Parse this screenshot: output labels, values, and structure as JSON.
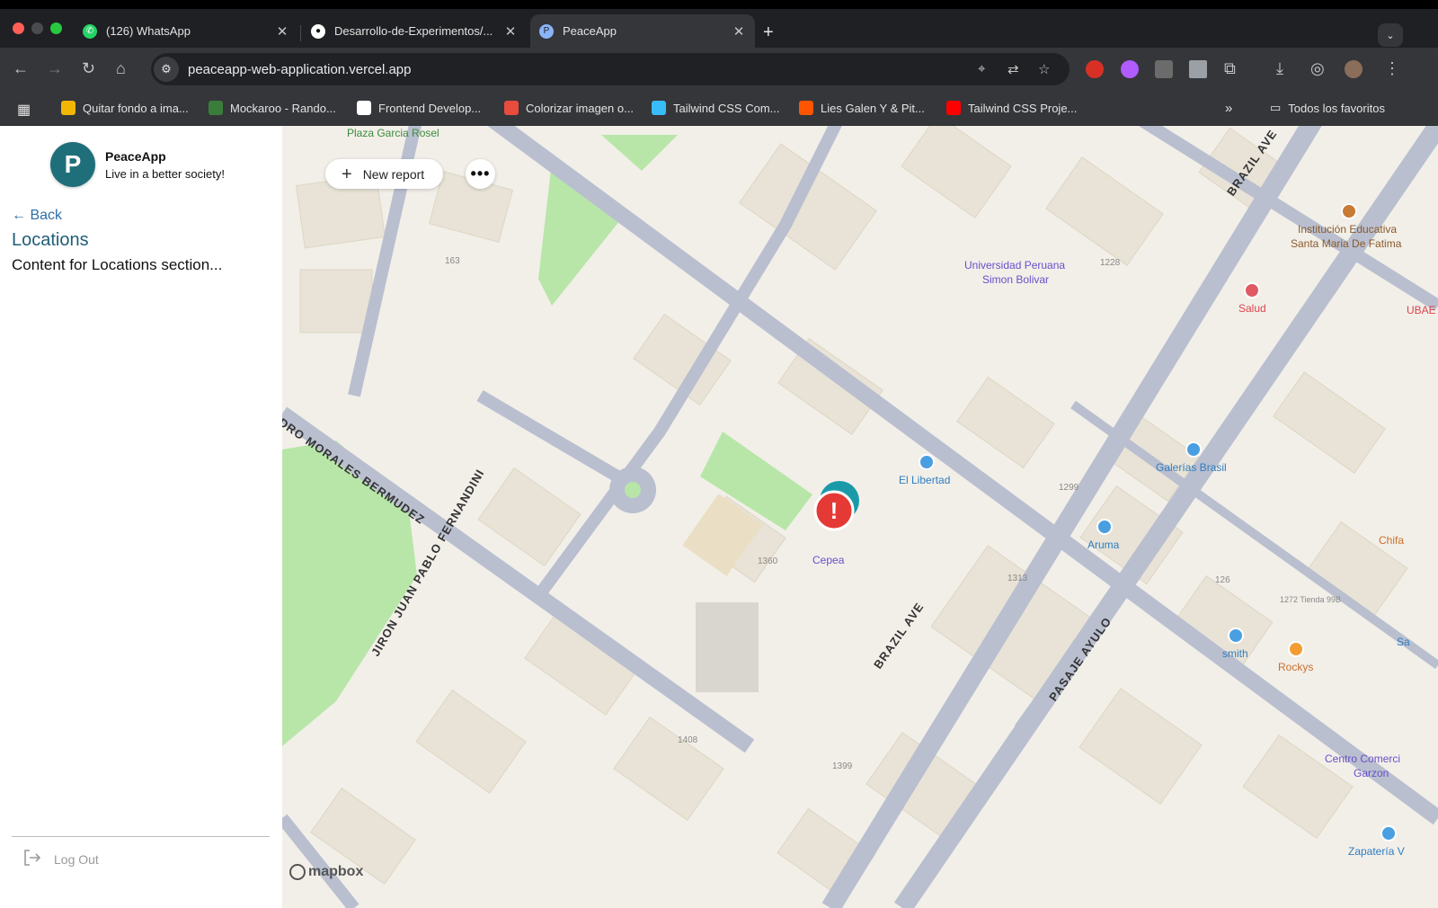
{
  "browser": {
    "tabs": [
      {
        "title": "(126) WhatsApp",
        "icon": "whatsapp-icon",
        "close": "✕"
      },
      {
        "title": "Desarrollo-de-Experimentos/...",
        "icon": "github-icon",
        "close": "✕"
      },
      {
        "title": "PeaceApp",
        "icon": "peaceapp-icon",
        "close": "✕"
      }
    ],
    "url": "peaceapp-web-application.vercel.app",
    "bookmarks": [
      {
        "label": "Quitar fondo a ima...",
        "color": "#f2b705"
      },
      {
        "label": "Mockaroo - Rando...",
        "color": "#3a7d3a"
      },
      {
        "label": "Frontend Develop...",
        "color": "#ffffff"
      },
      {
        "label": "Colorizar imagen o...",
        "color": "#e84c3d"
      },
      {
        "label": "Tailwind CSS Com...",
        "color": "#38bdf8"
      },
      {
        "label": "Lies Galen Y & Pit...",
        "color": "#ff5500"
      },
      {
        "label": "Tailwind CSS Proje...",
        "color": "#ff0000"
      }
    ],
    "bookmarks_overflow": "»",
    "all_bookmarks": "Todos los favoritos"
  },
  "app": {
    "name": "PeaceApp",
    "tagline": "Live in a better society!",
    "back": "← Back",
    "section_title": "Locations",
    "section_body": "Content for Locations section...",
    "logout": "Log Out"
  },
  "map": {
    "new_report": "New report",
    "more": "•••",
    "attribution": "mapbox",
    "labels": {
      "plaza": "Plaza Garcia Rosel",
      "universidad_1": "Universidad Peruana",
      "universidad_2": "Simon Bolivar",
      "institucion_1": "Institución Educativa",
      "institucion_2": "Santa Maria De Fatima",
      "salud": "Salud",
      "ubae": "UBAE",
      "el_libertad": "El Libertad",
      "galerias": "Galerías Brasil",
      "aruma": "Aruma",
      "cepea": "Cepea",
      "chifa": "Chifa",
      "smith": "smith",
      "rockys": "Rockys",
      "centro_1": "Centro Comerci",
      "centro_2": "Garzon",
      "zapateria": "Zapatería V",
      "sa": "Sa",
      "tienda": "1272 Tienda 99B"
    },
    "streets": {
      "brazil_top": "BRAZIL AVE",
      "brazil_mid": "BRAZIL AVE",
      "morales": "DRO MORALES BERMUDEZ",
      "jiron": "JIRON JUAN PABLO FERNANDINI",
      "ayulo": "PASAJE AYULO"
    },
    "numbers": [
      "163",
      "1228",
      "1299",
      "1313",
      "126",
      "1360",
      "1408",
      "1399"
    ]
  }
}
